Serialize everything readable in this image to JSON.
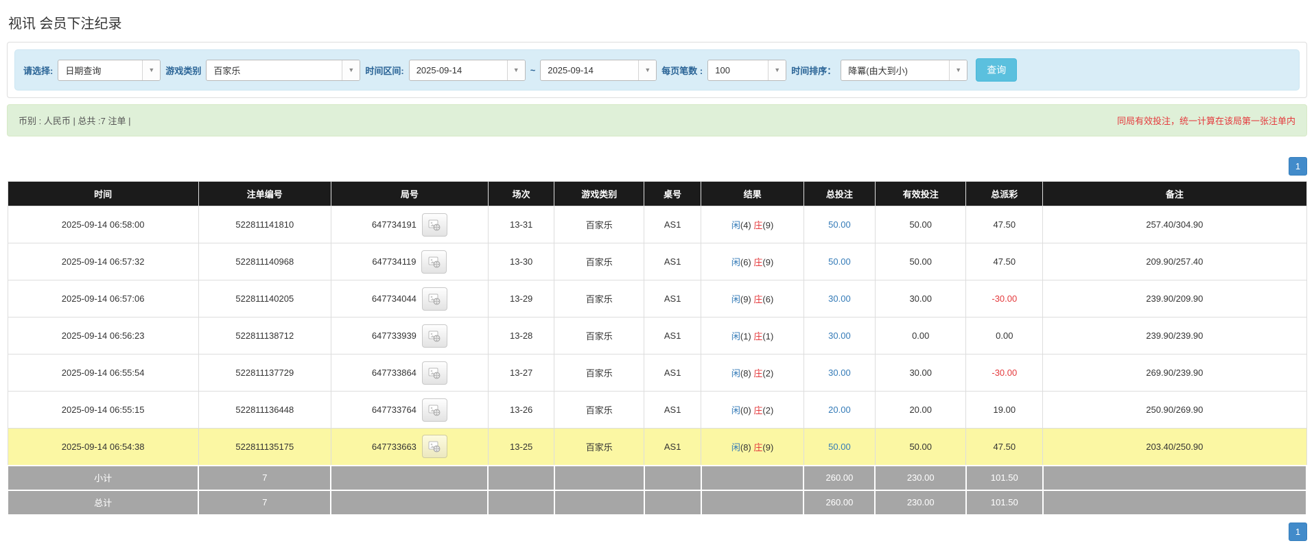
{
  "page": {
    "title": "视讯 会员下注纪录"
  },
  "filters": {
    "select_label": "请选择:",
    "select_value": "日期查询",
    "game_label": "游戏类别",
    "game_value": "百家乐",
    "range_label": "时间区间:",
    "date_from": "2025-09-14",
    "range_separator": "~",
    "date_to": "2025-09-14",
    "per_page_label": "每页笔数 :",
    "per_page_value": "100",
    "sort_label": "时间排序：",
    "sort_value": "降冪(由大到小)",
    "search_button": "查询"
  },
  "summary_bar": {
    "info": "币别 : 人民币 | 总共 :7 注单 |",
    "notice": "同局有效投注，统一计算在该局第一张注单内"
  },
  "pagination": {
    "page": "1"
  },
  "table": {
    "headers": [
      "时间",
      "注单编号",
      "局号",
      "场次",
      "游戏类别",
      "桌号",
      "结果",
      "总投注",
      "有效投注",
      "总派彩",
      "备注"
    ],
    "rows": [
      {
        "time": "2025-09-14 06:58:00",
        "bet_id": "522811141810",
        "round_id": "647734191",
        "session": "13-31",
        "game": "百家乐",
        "table_no": "AS1",
        "result": {
          "player": "闲",
          "player_score": "(4)",
          "banker": "庄",
          "banker_score": "(9)"
        },
        "total_bet": "50.00",
        "valid_bet": "50.00",
        "payout": "47.50",
        "note": "257.40/304.90",
        "highlight": false
      },
      {
        "time": "2025-09-14 06:57:32",
        "bet_id": "522811140968",
        "round_id": "647734119",
        "session": "13-30",
        "game": "百家乐",
        "table_no": "AS1",
        "result": {
          "player": "闲",
          "player_score": "(6)",
          "banker": "庄",
          "banker_score": "(9)"
        },
        "total_bet": "50.00",
        "valid_bet": "50.00",
        "payout": "47.50",
        "note": "209.90/257.40",
        "highlight": false
      },
      {
        "time": "2025-09-14 06:57:06",
        "bet_id": "522811140205",
        "round_id": "647734044",
        "session": "13-29",
        "game": "百家乐",
        "table_no": "AS1",
        "result": {
          "player": "闲",
          "player_score": "(9)",
          "banker": "庄",
          "banker_score": "(6)"
        },
        "total_bet": "30.00",
        "valid_bet": "30.00",
        "payout": "-30.00",
        "note": "239.90/209.90",
        "highlight": false
      },
      {
        "time": "2025-09-14 06:56:23",
        "bet_id": "522811138712",
        "round_id": "647733939",
        "session": "13-28",
        "game": "百家乐",
        "table_no": "AS1",
        "result": {
          "player": "闲",
          "player_score": "(1)",
          "banker": "庄",
          "banker_score": "(1)"
        },
        "total_bet": "30.00",
        "valid_bet": "0.00",
        "payout": "0.00",
        "note": "239.90/239.90",
        "highlight": false
      },
      {
        "time": "2025-09-14 06:55:54",
        "bet_id": "522811137729",
        "round_id": "647733864",
        "session": "13-27",
        "game": "百家乐",
        "table_no": "AS1",
        "result": {
          "player": "闲",
          "player_score": "(8)",
          "banker": "庄",
          "banker_score": "(2)"
        },
        "total_bet": "30.00",
        "valid_bet": "30.00",
        "payout": "-30.00",
        "note": "269.90/239.90",
        "highlight": false
      },
      {
        "time": "2025-09-14 06:55:15",
        "bet_id": "522811136448",
        "round_id": "647733764",
        "session": "13-26",
        "game": "百家乐",
        "table_no": "AS1",
        "result": {
          "player": "闲",
          "player_score": "(0)",
          "banker": "庄",
          "banker_score": "(2)"
        },
        "total_bet": "20.00",
        "valid_bet": "20.00",
        "payout": "19.00",
        "note": "250.90/269.90",
        "highlight": false
      },
      {
        "time": "2025-09-14 06:54:38",
        "bet_id": "522811135175",
        "round_id": "647733663",
        "session": "13-25",
        "game": "百家乐",
        "table_no": "AS1",
        "result": {
          "player": "闲",
          "player_score": "(8)",
          "banker": "庄",
          "banker_score": "(9)"
        },
        "total_bet": "50.00",
        "valid_bet": "50.00",
        "payout": "47.50",
        "note": "203.40/250.90",
        "highlight": true
      }
    ],
    "subtotal": {
      "label": "小计",
      "count": "7",
      "total_bet": "260.00",
      "valid_bet": "230.00",
      "payout": "101.50"
    },
    "grand_total": {
      "label": "总计",
      "count": "7",
      "total_bet": "260.00",
      "valid_bet": "230.00",
      "payout": "101.50"
    }
  },
  "colors": {
    "accent_blue": "#428bca",
    "search_button_blue": "#5bc0de",
    "link_blue": "#337ab7",
    "alert_red": "#e4393c",
    "highlight_yellow": "#fbf7a3",
    "header_black": "#1b1b1b",
    "summary_gray": "#a6a6a6",
    "filter_bg": "#d9edf7",
    "info_bg": "#dff0d8"
  }
}
